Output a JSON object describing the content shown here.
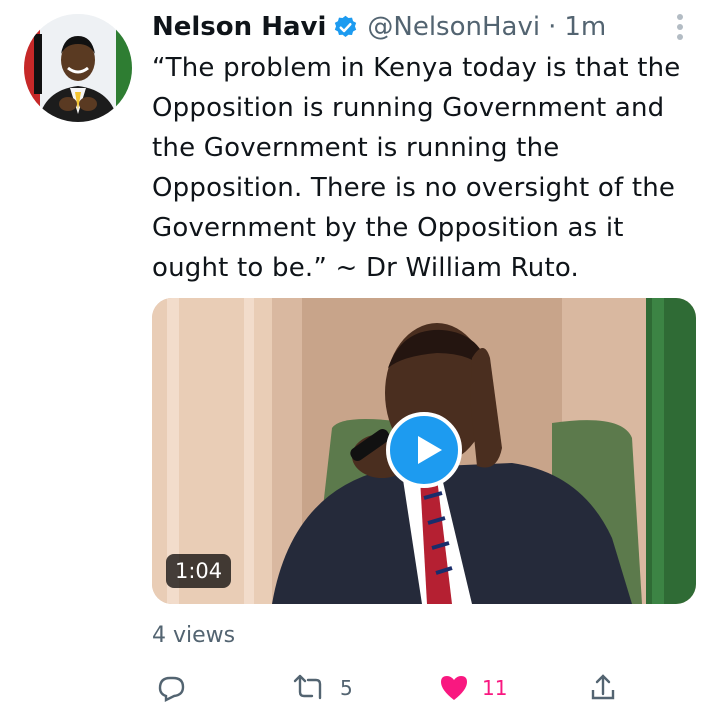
{
  "tweet": {
    "author_name": "Nelson Havi",
    "handle": "@NelsonHavi",
    "separator": "·",
    "time": "1m",
    "text": "“The problem in Kenya today is that the Opposition is running Government and the Government is running the Opposition. There is no oversight of the Government by the Opposition as it ought to be.” ~ Dr William Ruto.",
    "media": {
      "type": "video",
      "duration": "1:04",
      "play_icon": "play-icon"
    },
    "views": "4 views",
    "actions": {
      "reply_count": "",
      "retweet_count": "5",
      "like_count": "11",
      "share_count": ""
    }
  },
  "colors": {
    "accent": "#1d9bf0",
    "text": "#0f1419",
    "muted": "#536471",
    "like": "#f91880"
  },
  "icons": [
    "verified-badge-icon",
    "more-options-icon",
    "play-icon",
    "reply-icon",
    "retweet-icon",
    "like-icon",
    "share-icon"
  ]
}
